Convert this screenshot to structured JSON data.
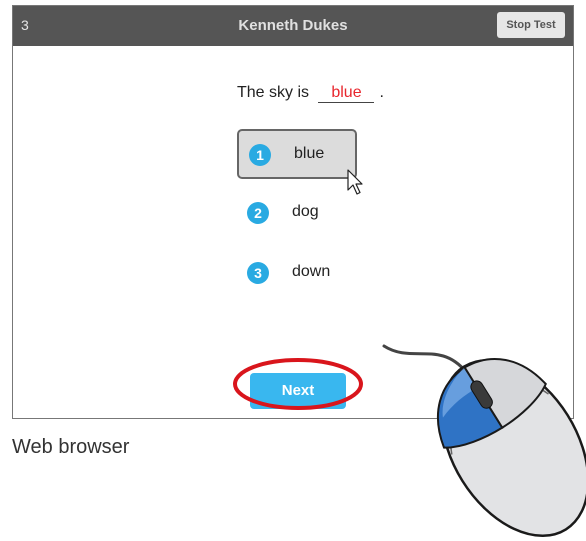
{
  "header": {
    "item_number": "3",
    "student_name": "Kenneth Dukes",
    "stop_label": "Stop Test"
  },
  "question": {
    "prefix": "The sky is",
    "answer": "blue",
    "suffix": "."
  },
  "options": [
    {
      "number": "1",
      "word": "blue",
      "selected": true
    },
    {
      "number": "2",
      "word": "dog",
      "selected": false
    },
    {
      "number": "3",
      "word": "down",
      "selected": false
    }
  ],
  "next_label": "Next",
  "caption": "Web browser",
  "colors": {
    "title_bar": "#555555",
    "accent_blue": "#29aae2",
    "answer_red": "#e8262d",
    "highlight_ellipse": "#d9151c"
  },
  "icons": [
    "mouse-pointer-icon",
    "computer-mouse-icon"
  ]
}
